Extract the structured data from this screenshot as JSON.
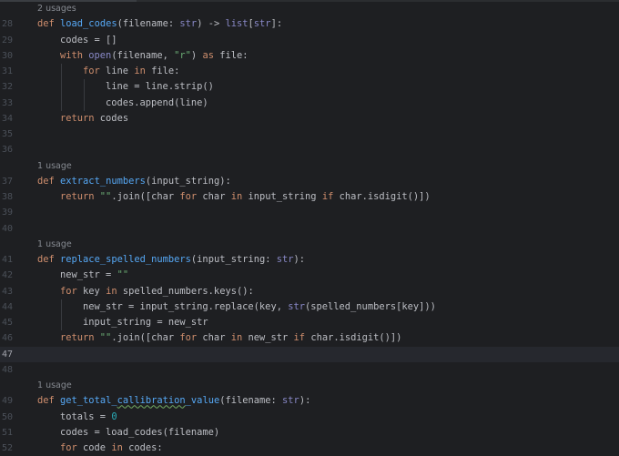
{
  "editor": {
    "current_line": 47,
    "lines": [
      {
        "hint": "2 usages"
      },
      {
        "n": "28",
        "indent": 0,
        "t": [
          [
            "def ",
            "kw"
          ],
          [
            "load_codes",
            "fn"
          ],
          [
            "(filename: ",
            "txt"
          ],
          [
            "str",
            "bi"
          ],
          [
            ") -> ",
            "txt"
          ],
          [
            "list",
            "bi"
          ],
          [
            "[",
            "txt"
          ],
          [
            "str",
            "bi"
          ],
          [
            "]:",
            "txt"
          ]
        ]
      },
      {
        "n": "29",
        "indent": 1,
        "t": [
          [
            "codes = []",
            "txt"
          ]
        ]
      },
      {
        "n": "30",
        "indent": 1,
        "t": [
          [
            "with ",
            "kw"
          ],
          [
            "open",
            "bi"
          ],
          [
            "(filename, ",
            "txt"
          ],
          [
            "\"r\"",
            "str"
          ],
          [
            ") ",
            "txt"
          ],
          [
            "as ",
            "kw"
          ],
          [
            "file:",
            "txt"
          ]
        ]
      },
      {
        "n": "31",
        "indent": 2,
        "t": [
          [
            "for ",
            "kw"
          ],
          [
            "line ",
            "txt"
          ],
          [
            "in ",
            "kw"
          ],
          [
            "file:",
            "txt"
          ]
        ]
      },
      {
        "n": "32",
        "indent": 3,
        "t": [
          [
            "line = line.strip()",
            "txt"
          ]
        ]
      },
      {
        "n": "33",
        "indent": 3,
        "t": [
          [
            "codes.append(line)",
            "txt"
          ]
        ]
      },
      {
        "n": "34",
        "indent": 1,
        "t": [
          [
            "return ",
            "kw"
          ],
          [
            "codes",
            "txt"
          ]
        ]
      },
      {
        "n": "35",
        "indent": 0,
        "t": []
      },
      {
        "n": "36",
        "indent": 0,
        "t": []
      },
      {
        "hint": "1 usage"
      },
      {
        "n": "37",
        "indent": 0,
        "t": [
          [
            "def ",
            "kw"
          ],
          [
            "extract_numbers",
            "fn"
          ],
          [
            "(input_string):",
            "txt"
          ]
        ]
      },
      {
        "n": "38",
        "indent": 1,
        "t": [
          [
            "return ",
            "kw"
          ],
          [
            "\"\"",
            "str"
          ],
          [
            ".join([char ",
            "txt"
          ],
          [
            "for ",
            "kw"
          ],
          [
            "char ",
            "txt"
          ],
          [
            "in ",
            "kw"
          ],
          [
            "input_string ",
            "txt"
          ],
          [
            "if ",
            "kw"
          ],
          [
            "char.isdigit()])",
            "txt"
          ]
        ]
      },
      {
        "n": "39",
        "indent": 0,
        "t": []
      },
      {
        "n": "40",
        "indent": 0,
        "t": []
      },
      {
        "hint": "1 usage"
      },
      {
        "n": "41",
        "indent": 0,
        "t": [
          [
            "def ",
            "kw"
          ],
          [
            "replace_spelled_numbers",
            "fn"
          ],
          [
            "(input_string: ",
            "txt"
          ],
          [
            "str",
            "bi"
          ],
          [
            "):",
            "txt"
          ]
        ]
      },
      {
        "n": "42",
        "indent": 1,
        "t": [
          [
            "new_str = ",
            "txt"
          ],
          [
            "\"\"",
            "str"
          ]
        ]
      },
      {
        "n": "43",
        "indent": 1,
        "t": [
          [
            "for ",
            "kw"
          ],
          [
            "key ",
            "txt"
          ],
          [
            "in ",
            "kw"
          ],
          [
            "spelled_numbers.keys():",
            "txt"
          ]
        ]
      },
      {
        "n": "44",
        "indent": 2,
        "t": [
          [
            "new_str = input_string.replace(key, ",
            "txt"
          ],
          [
            "str",
            "bi"
          ],
          [
            "(spelled_numbers[key]))",
            "txt"
          ]
        ]
      },
      {
        "n": "45",
        "indent": 2,
        "t": [
          [
            "input_string = new_str",
            "txt"
          ]
        ]
      },
      {
        "n": "46",
        "indent": 1,
        "t": [
          [
            "return ",
            "kw"
          ],
          [
            "\"\"",
            "str"
          ],
          [
            ".join([char ",
            "txt"
          ],
          [
            "for ",
            "kw"
          ],
          [
            "char ",
            "txt"
          ],
          [
            "in ",
            "kw"
          ],
          [
            "new_str ",
            "txt"
          ],
          [
            "if ",
            "kw"
          ],
          [
            "char.isdigit()])",
            "txt"
          ]
        ]
      },
      {
        "n": "47",
        "indent": 0,
        "t": []
      },
      {
        "n": "48",
        "indent": 0,
        "t": []
      },
      {
        "hint": "1 usage"
      },
      {
        "n": "49",
        "indent": 0,
        "t": [
          [
            "def ",
            "kw"
          ],
          [
            "get_total_",
            "fn"
          ],
          [
            "callibration",
            "fn typo"
          ],
          [
            "_value",
            "fn"
          ],
          [
            "(filename: ",
            "txt"
          ],
          [
            "str",
            "bi"
          ],
          [
            "):",
            "txt"
          ]
        ]
      },
      {
        "n": "50",
        "indent": 1,
        "t": [
          [
            "totals = ",
            "txt"
          ],
          [
            "0",
            "num"
          ]
        ]
      },
      {
        "n": "51",
        "indent": 1,
        "t": [
          [
            "codes = load_codes(filename)",
            "txt"
          ]
        ]
      },
      {
        "n": "52",
        "indent": 1,
        "t": [
          [
            "for ",
            "kw"
          ],
          [
            "code ",
            "txt"
          ],
          [
            "in ",
            "kw"
          ],
          [
            "codes:",
            "txt"
          ]
        ]
      }
    ]
  }
}
